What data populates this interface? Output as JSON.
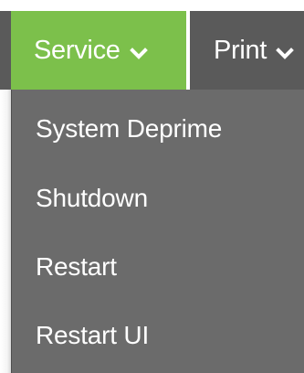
{
  "nav": {
    "items": [
      {
        "label": "Service",
        "icon": "chevron-down-icon",
        "active": true
      },
      {
        "label": "Print",
        "icon": "chevron-down-icon",
        "active": false
      }
    ]
  },
  "dropdown": {
    "items": [
      {
        "label": "System Deprime"
      },
      {
        "label": "Shutdown"
      },
      {
        "label": "Restart"
      },
      {
        "label": "Restart UI"
      }
    ]
  },
  "colors": {
    "active_tab": "#7cc04b",
    "nav_bg": "#5a5a5a",
    "dropdown_bg": "#6b6b6b",
    "text": "#ffffff"
  }
}
